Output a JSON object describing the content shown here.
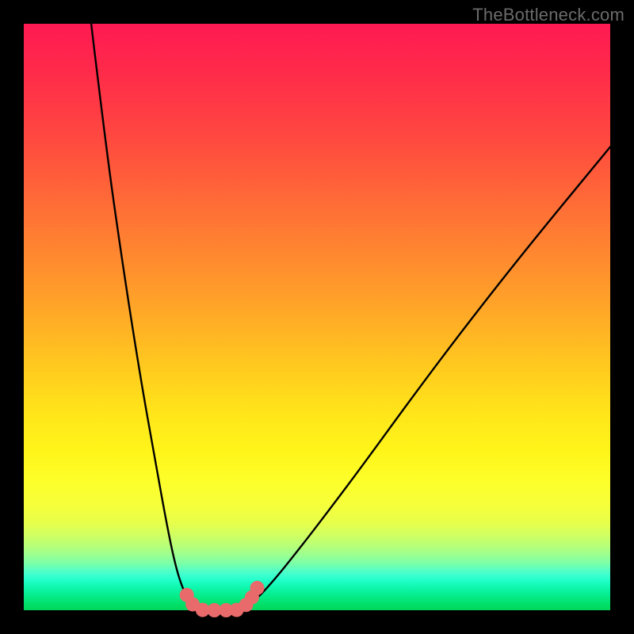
{
  "watermark": "TheBottleneck.com",
  "chart_data": {
    "type": "line",
    "title": "",
    "xlabel": "",
    "ylabel": "",
    "xlim": [
      0,
      100
    ],
    "ylim": [
      0,
      100
    ],
    "series": [
      {
        "name": "left-branch",
        "x": [
          11.5,
          14,
          17,
          20,
          22.5,
          24.5,
          26,
          27.3,
          28.3,
          29.1,
          29.8
        ],
        "y": [
          100,
          79,
          58,
          39,
          25,
          14,
          7,
          3.2,
          1.4,
          0.5,
          0.1
        ]
      },
      {
        "name": "floor",
        "x": [
          29.8,
          31,
          33,
          35,
          37
        ],
        "y": [
          0.1,
          0,
          0,
          0,
          0.1
        ]
      },
      {
        "name": "right-branch",
        "x": [
          37,
          38.3,
          40,
          43,
          47,
          52,
          58,
          66,
          75,
          86,
          100
        ],
        "y": [
          0.1,
          0.8,
          2.2,
          5.5,
          10.5,
          17,
          25,
          36,
          48,
          62,
          79
        ]
      }
    ],
    "markers": {
      "name": "highlight-points",
      "color": "#e86a6a",
      "radius_px": 9,
      "points": [
        {
          "x": 27.8,
          "y": 2.6
        },
        {
          "x": 28.8,
          "y": 1.0
        },
        {
          "x": 30.5,
          "y": 0.05
        },
        {
          "x": 32.5,
          "y": 0.0
        },
        {
          "x": 34.5,
          "y": 0.0
        },
        {
          "x": 36.3,
          "y": 0.05
        },
        {
          "x": 37.9,
          "y": 0.9
        },
        {
          "x": 38.9,
          "y": 2.2
        },
        {
          "x": 39.8,
          "y": 3.8
        }
      ]
    },
    "background_gradient": {
      "orientation": "vertical",
      "stops": [
        {
          "pos": 0.0,
          "color": "#ff1a52"
        },
        {
          "pos": 0.5,
          "color": "#ffb81f"
        },
        {
          "pos": 0.8,
          "color": "#fdff2a"
        },
        {
          "pos": 1.0,
          "color": "#00d75c"
        }
      ]
    }
  }
}
